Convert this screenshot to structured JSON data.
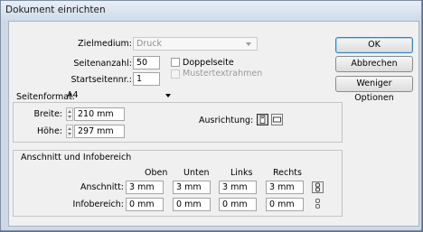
{
  "window": {
    "title": "Dokument einrichten"
  },
  "form": {
    "zielmedium": {
      "label": "Zielmedium:",
      "value": "Druck"
    },
    "seitenanzahl": {
      "label": "Seitenanzahl:",
      "value": "50"
    },
    "startseite": {
      "label": "Startseitennr.:",
      "value": "1"
    },
    "doppelseite": {
      "label": "Doppelseite",
      "checked": false
    },
    "mustertextrahmen": {
      "label": "Mustertextrahmen",
      "checked": false,
      "disabled": true
    },
    "seitenformat": {
      "label": "Seitenformat:",
      "value": "A4"
    },
    "breite": {
      "label": "Breite:",
      "value": "210 mm"
    },
    "hoehe": {
      "label": "Höhe:",
      "value": "297 mm"
    },
    "ausrichtung": {
      "label": "Ausrichtung:",
      "selected": "hochformat"
    }
  },
  "bleed": {
    "title": "Anschnitt und Infobereich",
    "columns": [
      "Oben",
      "Unten",
      "Links",
      "Rechts"
    ],
    "anschnitt": {
      "label": "Anschnitt:",
      "values": [
        "3 mm",
        "3 mm",
        "3 mm",
        "3 mm"
      ]
    },
    "infobereich": {
      "label": "Infobereich:",
      "values": [
        "0 mm",
        "0 mm",
        "0 mm",
        "0 mm"
      ]
    }
  },
  "buttons": {
    "ok": "OK",
    "cancel": "Abbrechen",
    "fewer": "Weniger Optionen"
  }
}
